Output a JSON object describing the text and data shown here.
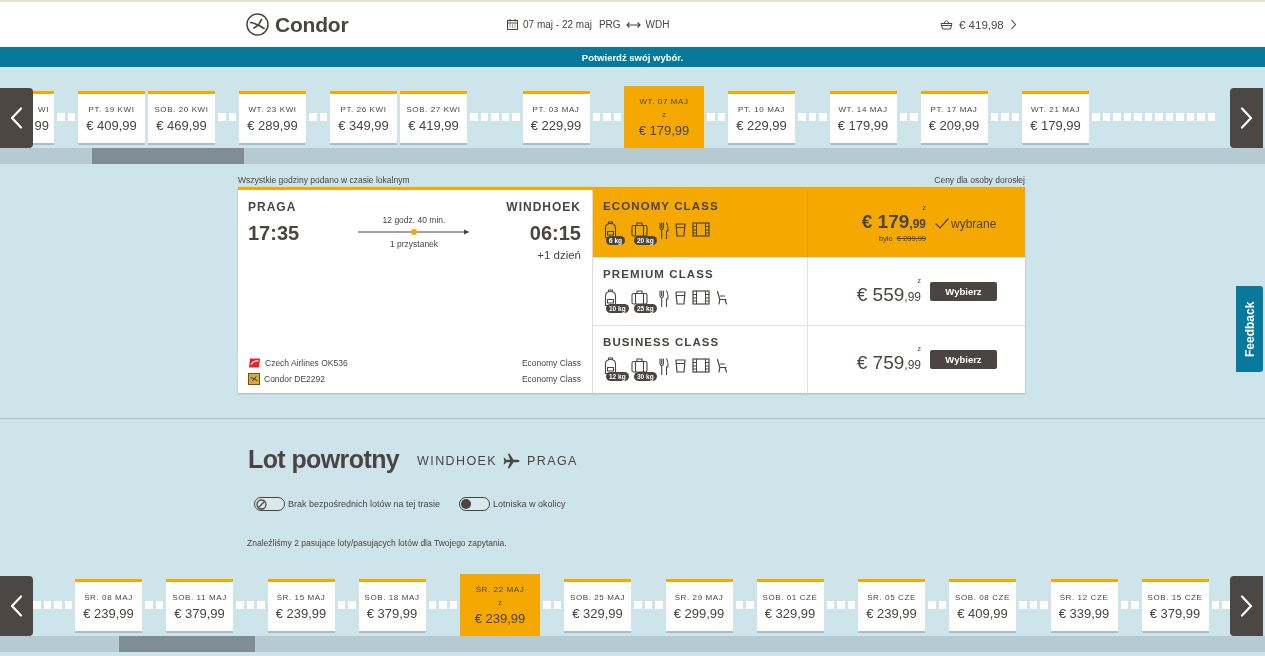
{
  "header": {
    "logo_text": "Condor",
    "dates": "07 maj - 22 maj",
    "origin": "PRG",
    "destination": "WDH",
    "basket_total": "€ 419,98"
  },
  "banner": {
    "text": "Potwierdź swój wybór."
  },
  "outbound_dates": {
    "days": [
      {
        "kind": "partial",
        "label": "WI",
        "price": "99",
        "selected": false
      },
      {
        "kind": "empty",
        "selected": false
      },
      {
        "kind": "empty",
        "selected": false
      },
      {
        "kind": "card",
        "label": "PT. 19 KWI",
        "price": "€ 409,99",
        "selected": false
      },
      {
        "kind": "card",
        "label": "SOB. 20 KWI",
        "price": "€ 469,99",
        "selected": false
      },
      {
        "kind": "empty",
        "selected": false
      },
      {
        "kind": "empty",
        "selected": false
      },
      {
        "kind": "card",
        "label": "WT. 23 KWI",
        "price": "€ 289,99",
        "selected": false
      },
      {
        "kind": "empty",
        "selected": false
      },
      {
        "kind": "empty",
        "selected": false
      },
      {
        "kind": "card",
        "label": "PT. 26 KWI",
        "price": "€ 349,99",
        "selected": false
      },
      {
        "kind": "card",
        "label": "SOB. 27 KWI",
        "price": "€ 419,99",
        "selected": false
      },
      {
        "kind": "empty",
        "selected": false
      },
      {
        "kind": "empty",
        "selected": false
      },
      {
        "kind": "empty",
        "selected": false
      },
      {
        "kind": "empty",
        "selected": false
      },
      {
        "kind": "empty",
        "selected": false
      },
      {
        "kind": "card",
        "label": "PT. 03 MAJ",
        "price": "€ 229,99",
        "selected": false
      },
      {
        "kind": "empty",
        "selected": false
      },
      {
        "kind": "empty",
        "selected": false
      },
      {
        "kind": "empty",
        "selected": false
      },
      {
        "kind": "card",
        "label": "WT. 07 MAJ",
        "from_label": "z",
        "price": "€ 179,99",
        "selected": true
      },
      {
        "kind": "empty",
        "selected": false
      },
      {
        "kind": "empty",
        "selected": false
      },
      {
        "kind": "card",
        "label": "PT. 10 MAJ",
        "price": "€ 229,99",
        "selected": false
      },
      {
        "kind": "empty",
        "selected": false
      },
      {
        "kind": "empty",
        "selected": false
      },
      {
        "kind": "empty",
        "selected": false
      },
      {
        "kind": "card",
        "label": "WT. 14 MAJ",
        "price": "€ 179,99",
        "selected": false
      },
      {
        "kind": "empty",
        "selected": false
      },
      {
        "kind": "empty",
        "selected": false
      },
      {
        "kind": "card",
        "label": "PT. 17 MAJ",
        "price": "€ 209,99",
        "selected": false
      },
      {
        "kind": "empty",
        "selected": false
      },
      {
        "kind": "empty",
        "selected": false
      },
      {
        "kind": "empty",
        "selected": false
      },
      {
        "kind": "card",
        "label": "WT. 21 MAJ",
        "price": "€ 179,99",
        "selected": false
      },
      {
        "kind": "empty",
        "selected": false
      },
      {
        "kind": "empty",
        "selected": false
      },
      {
        "kind": "empty",
        "selected": false
      },
      {
        "kind": "empty",
        "selected": false
      },
      {
        "kind": "empty",
        "selected": false
      },
      {
        "kind": "empty",
        "selected": false
      },
      {
        "kind": "empty",
        "selected": false
      },
      {
        "kind": "empty",
        "selected": false
      },
      {
        "kind": "empty",
        "selected": false
      },
      {
        "kind": "empty",
        "selected": false
      },
      {
        "kind": "empty",
        "selected": false
      },
      {
        "kind": "empty",
        "selected": false
      }
    ]
  },
  "notes": {
    "timezone": "Wszystkie godziny podano w czasie lokalnym",
    "price_basis": "Ceny dla osoby dorosłej"
  },
  "flight": {
    "origin": "PRAGA",
    "departure": "17:35",
    "duration": "12 godz. 40 min.",
    "stops": "1 przystanek",
    "destination": "WINDHOEK",
    "arrival": "06:15",
    "day_offset": "+1 dzień",
    "segments": [
      {
        "kind": "red",
        "airline": "Czech Airlines OK536",
        "cabin": "Economy Class"
      },
      {
        "kind": "gold",
        "airline": "Condor DE2292",
        "cabin": "Economy Class"
      }
    ]
  },
  "fares": [
    {
      "name": "ECONOMY CLASS",
      "selected": true,
      "baggage": [
        {
          "kind": "backpack",
          "weight": "6 kg"
        },
        {
          "kind": "suitcase",
          "weight": "20 kg"
        }
      ],
      "amenities": [
        {
          "kind": "meal"
        },
        {
          "kind": "drink"
        },
        {
          "kind": "film"
        }
      ],
      "from_label": "z",
      "amount": "€ 179",
      "cents": ",99",
      "old_label": "było",
      "old_price": "€ 209,99",
      "status": "wybrane"
    },
    {
      "name": "PREMIUM CLASS",
      "selected": false,
      "baggage": [
        {
          "kind": "backpack",
          "weight": "10 kg"
        },
        {
          "kind": "suitcase",
          "weight": "25 kg"
        }
      ],
      "amenities": [
        {
          "kind": "meal"
        },
        {
          "kind": "drink"
        },
        {
          "kind": "film"
        },
        {
          "kind": "seat"
        }
      ],
      "from_label": "z",
      "amount": "€ 559",
      "cents": ",99",
      "button": "Wybierz"
    },
    {
      "name": "BUSINESS CLASS",
      "selected": false,
      "baggage": [
        {
          "kind": "backpack",
          "weight": "12 kg"
        },
        {
          "kind": "suitcase",
          "weight": "30 kg"
        }
      ],
      "amenities": [
        {
          "kind": "meal"
        },
        {
          "kind": "drink"
        },
        {
          "kind": "film"
        },
        {
          "kind": "seat"
        }
      ],
      "from_label": "z",
      "amount": "€ 759",
      "cents": ",99",
      "button": "Wybierz"
    }
  ],
  "return": {
    "title": "Lot powrotny",
    "origin": "WINDHOEK",
    "destination": "PRAGA",
    "filters": [
      {
        "label": "Brak bezpośrednich lotów na tej trasie",
        "on": false,
        "disabled": true
      },
      {
        "label": "Lotniska w okolicy",
        "on": false,
        "disabled": false
      }
    ],
    "results_note": "Znaleźliśmy 2 pasujące loty/pasujących lotów dla Twojego zapytania.",
    "days": [
      {
        "kind": "empty",
        "selected": false
      },
      {
        "kind": "empty",
        "selected": false
      },
      {
        "kind": "empty",
        "selected": false
      },
      {
        "kind": "empty",
        "selected": false
      },
      {
        "kind": "card",
        "label": "ŚR. 08 MAJ",
        "price": "€ 239,99",
        "selected": false
      },
      {
        "kind": "empty",
        "selected": false
      },
      {
        "kind": "empty",
        "selected": false
      },
      {
        "kind": "card",
        "label": "SOB. 11 MAJ",
        "price": "€ 379,99",
        "selected": false
      },
      {
        "kind": "empty",
        "selected": false
      },
      {
        "kind": "empty",
        "selected": false
      },
      {
        "kind": "empty",
        "selected": false
      },
      {
        "kind": "card",
        "label": "ŚR. 15 MAJ",
        "price": "€ 239,99",
        "selected": false
      },
      {
        "kind": "empty",
        "selected": false
      },
      {
        "kind": "empty",
        "selected": false
      },
      {
        "kind": "card",
        "label": "SOB. 18 MAJ",
        "price": "€ 379,99",
        "selected": false
      },
      {
        "kind": "empty",
        "selected": false
      },
      {
        "kind": "empty",
        "selected": false
      },
      {
        "kind": "empty",
        "selected": false
      },
      {
        "kind": "card",
        "label": "ŚR. 22 MAJ",
        "from_label": "z",
        "price": "€ 239,99",
        "selected": true
      },
      {
        "kind": "empty",
        "selected": false
      },
      {
        "kind": "empty",
        "selected": false
      },
      {
        "kind": "card",
        "label": "SOB. 25 MAJ",
        "price": "€ 329,99",
        "selected": false
      },
      {
        "kind": "empty",
        "selected": false
      },
      {
        "kind": "empty",
        "selected": false
      },
      {
        "kind": "empty",
        "selected": false
      },
      {
        "kind": "card",
        "label": "ŚR. 29 MAJ",
        "price": "€ 299,99",
        "selected": false
      },
      {
        "kind": "empty",
        "selected": false
      },
      {
        "kind": "empty",
        "selected": false
      },
      {
        "kind": "card",
        "label": "SOB. 01 CZE",
        "price": "€ 329,99",
        "selected": false
      },
      {
        "kind": "empty",
        "selected": false
      },
      {
        "kind": "empty",
        "selected": false
      },
      {
        "kind": "empty",
        "selected": false
      },
      {
        "kind": "card",
        "label": "ŚR. 05 CZE",
        "price": "€ 239,99",
        "selected": false
      },
      {
        "kind": "empty",
        "selected": false
      },
      {
        "kind": "empty",
        "selected": false
      },
      {
        "kind": "card",
        "label": "SOB. 08 CZE",
        "price": "€ 409,99",
        "selected": false
      },
      {
        "kind": "empty",
        "selected": false
      },
      {
        "kind": "empty",
        "selected": false
      },
      {
        "kind": "empty",
        "selected": false
      },
      {
        "kind": "card",
        "label": "ŚR. 12 CZE",
        "price": "€ 339,99",
        "selected": false
      },
      {
        "kind": "empty",
        "selected": false
      },
      {
        "kind": "empty",
        "selected": false
      },
      {
        "kind": "card",
        "label": "SOB. 15 CZE",
        "price": "€ 379,99",
        "selected": false
      },
      {
        "kind": "empty",
        "selected": false
      },
      {
        "kind": "empty",
        "selected": false
      }
    ]
  },
  "feedback": {
    "label": "Feedback"
  }
}
